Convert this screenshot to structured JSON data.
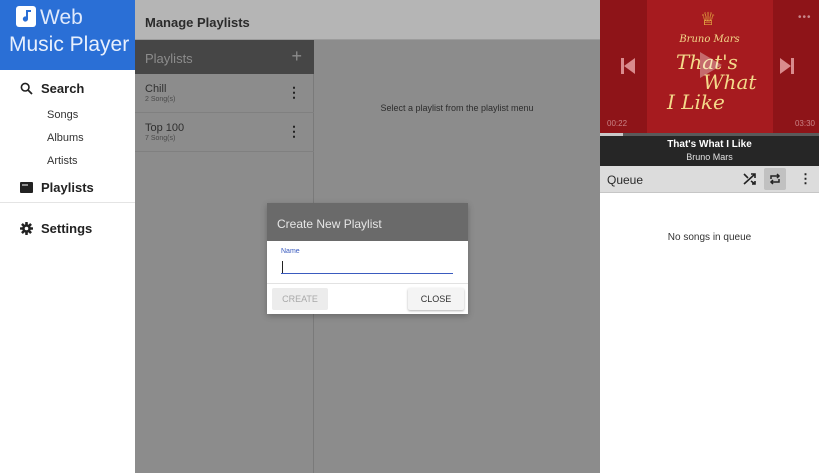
{
  "app": {
    "logo_line1": "Web",
    "logo_line2": "Music Player",
    "accent_color": "#2a6fd6"
  },
  "sidebar": {
    "search": {
      "label": "Search",
      "icon": "search-icon"
    },
    "search_items": [
      {
        "label": "Songs"
      },
      {
        "label": "Albums"
      },
      {
        "label": "Artists"
      }
    ],
    "playlists": {
      "label": "Playlists",
      "icon": "playlist-icon"
    },
    "settings": {
      "label": "Settings",
      "icon": "gear-icon"
    }
  },
  "header": {
    "title": "Manage Playlists"
  },
  "playlists_panel": {
    "title": "Playlists",
    "add_icon": "plus-icon",
    "items": [
      {
        "name": "Chill",
        "count": "2 Song(s)"
      },
      {
        "name": "Top 100",
        "count": "7 Song(s)"
      }
    ]
  },
  "content": {
    "empty_message": "Select a playlist from the playlist menu"
  },
  "dialog": {
    "title": "Create New Playlist",
    "field_label": "Name",
    "field_value": "",
    "create_label": "CREATE",
    "close_label": "CLOSE"
  },
  "player": {
    "cover_artist": "Bruno Mars",
    "cover_title_line1": "That's",
    "cover_title_line2": "What",
    "cover_title_line3": "I Like",
    "current_time": "00:22",
    "duration": "03:30",
    "progress": 0.105,
    "song_title": "That's What I Like",
    "artist": "Bruno Mars",
    "cover_color": "#a61b1f"
  },
  "queue": {
    "label": "Queue",
    "empty_message": "No songs in queue",
    "shuffle_icon": "shuffle-icon",
    "repeat_icon": "repeat-icon",
    "repeat_active": true
  }
}
